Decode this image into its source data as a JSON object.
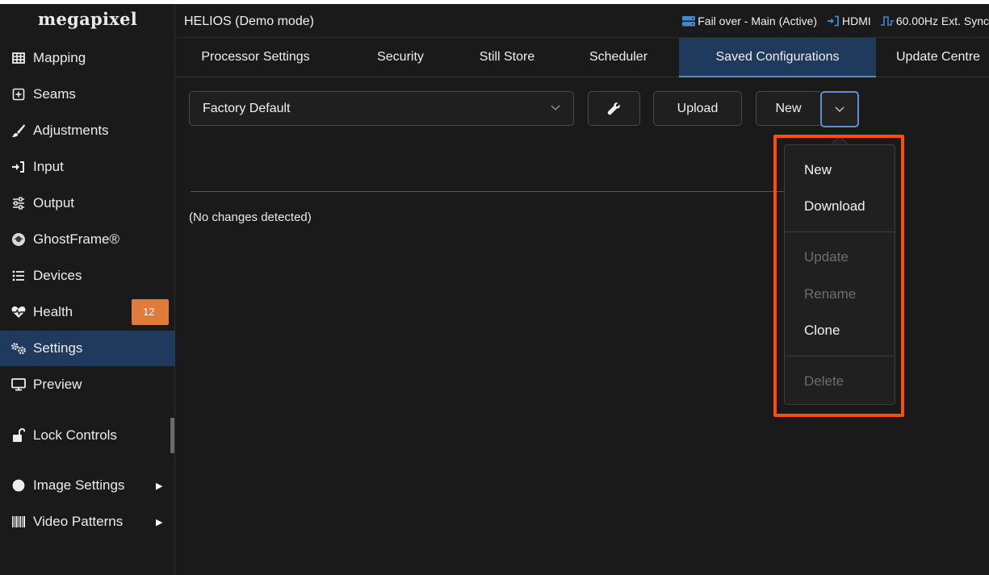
{
  "sidebar": {
    "logo": "megapixel",
    "items": [
      {
        "label": "Mapping",
        "icon": "grid-icon"
      },
      {
        "label": "Seams",
        "icon": "plus-square-icon"
      },
      {
        "label": "Adjustments",
        "icon": "brush-icon"
      },
      {
        "label": "Input",
        "icon": "sign-in-icon"
      },
      {
        "label": "Output",
        "icon": "sliders-icon"
      },
      {
        "label": "GhostFrame®",
        "icon": "ghostframe-icon"
      },
      {
        "label": "Devices",
        "icon": "list-icon"
      },
      {
        "label": "Health",
        "icon": "heartbeat-icon",
        "badge": "12"
      },
      {
        "label": "Settings",
        "icon": "cogs-icon",
        "active": true
      },
      {
        "label": "Preview",
        "icon": "monitor-icon"
      },
      {
        "label": "Lock Controls",
        "icon": "unlock-icon"
      },
      {
        "label": "Image Settings",
        "icon": "contrast-icon",
        "submenu": true
      },
      {
        "label": "Video Patterns",
        "icon": "barcode-icon",
        "submenu": true
      }
    ]
  },
  "header": {
    "title": "HELIOS (Demo mode)",
    "status": {
      "failover": "Fail over - Main (Active)",
      "input": "HDMI",
      "sync": "60.00Hz Ext. Sync"
    }
  },
  "tabs": [
    {
      "label": "Processor Settings"
    },
    {
      "label": "Security"
    },
    {
      "label": "Still Store"
    },
    {
      "label": "Scheduler"
    },
    {
      "label": "Saved Configurations",
      "active": true
    },
    {
      "label": "Update Centre"
    }
  ],
  "content": {
    "config_select_value": "Factory Default",
    "upload_label": "Upload",
    "new_label": "New",
    "no_changes_text": "(No changes detected)"
  },
  "dropdown": {
    "items": [
      {
        "label": "New",
        "enabled": true
      },
      {
        "label": "Download",
        "enabled": true
      },
      {
        "label": "Update",
        "enabled": false
      },
      {
        "label": "Rename",
        "enabled": false
      },
      {
        "label": "Clone",
        "enabled": true
      },
      {
        "label": "Delete",
        "enabled": false
      }
    ]
  },
  "colors": {
    "background": "#1a1a1a",
    "active_nav": "#1f3a5c",
    "accent_blue": "#4a8fd6",
    "badge_orange": "#e07b39",
    "highlight_orange": "#ff4d0f"
  }
}
